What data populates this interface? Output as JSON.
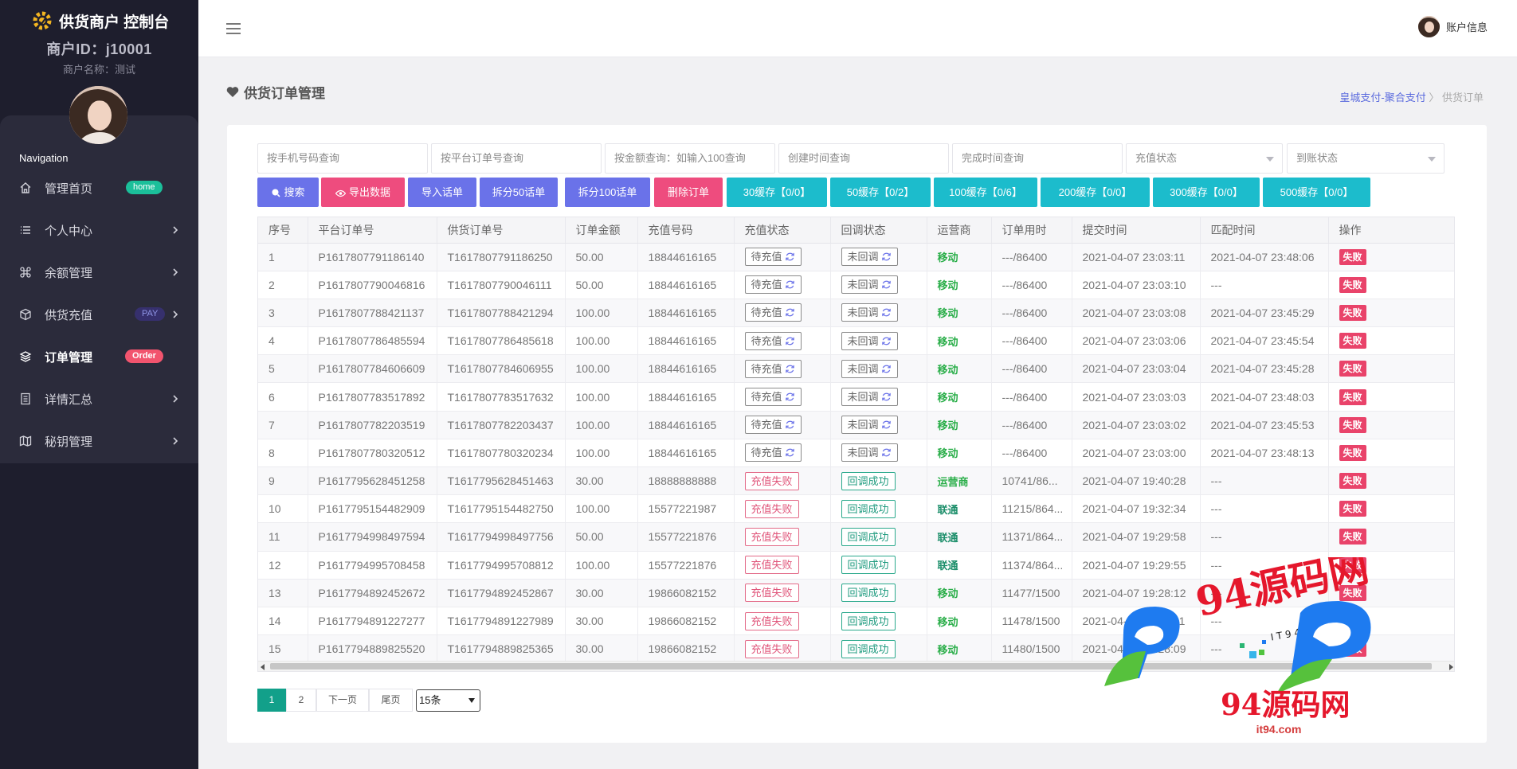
{
  "sidebar": {
    "brand": "供货商户 控制台",
    "merchant_id": "商户ID：j10001",
    "merchant_name": "商户名称：测试",
    "nav_heading": "Navigation",
    "items": [
      {
        "label": "管理首页",
        "badge": "home",
        "icon": "home-icon"
      },
      {
        "label": "个人中心",
        "icon": "list-icon"
      },
      {
        "label": "余额管理",
        "icon": "command-icon"
      },
      {
        "label": "供货充值",
        "badge": "PAY",
        "icon": "box-icon"
      },
      {
        "label": "订单管理",
        "badge": "Order",
        "icon": "layers-icon",
        "active": true
      },
      {
        "label": "详情汇总",
        "icon": "document-icon"
      },
      {
        "label": "秘钥管理",
        "icon": "map-icon"
      }
    ]
  },
  "topbar": {
    "account": "账户信息"
  },
  "page": {
    "title": "供货订单管理",
    "breadcrumb_link": "皇城支付-聚合支付",
    "breadcrumb_sep": "〉",
    "breadcrumb_current": "供货订单"
  },
  "filters": {
    "phone": "按手机号码查询",
    "platform_order": "按平台订单号查询",
    "amount": "按金额查询：如输入100查询",
    "created_time": "创建时间查询",
    "finished_time": "完成时间查询",
    "recharge_status": "充值状态",
    "settle_status": "到账状态"
  },
  "buttons": {
    "search": "搜索",
    "export": "导出数据",
    "import": "导入话单",
    "split50": "拆分50话单",
    "split100": "拆分100话单",
    "delete": "删除订单",
    "cache30": "30缓存【0/0】",
    "cache50": "50缓存【0/2】",
    "cache100": "100缓存【0/6】",
    "cache200": "200缓存【0/0】",
    "cache300": "300缓存【0/0】",
    "cache500": "500缓存【0/0】"
  },
  "colors": {
    "primary": "#6a72e9",
    "pink": "#ee4c7e",
    "teal": "#1cbccc",
    "sidebar": "#1e1e2d",
    "active_page": "#12a08a"
  },
  "table": {
    "headers": [
      "序号",
      "平台订单号",
      "供货订单号",
      "订单金额",
      "充值号码",
      "充值状态",
      "回调状态",
      "运营商",
      "订单用时",
      "提交时间",
      "匹配时间",
      "操作"
    ],
    "rows": [
      [
        "1",
        "P1617807791186140",
        "T1617807791186250",
        "50.00",
        "18844616165",
        "待充值",
        "未回调",
        "移动",
        "---/86400",
        "2021-04-07 23:03:11",
        "2021-04-07 23:48:06",
        "失败"
      ],
      [
        "2",
        "P1617807790046816",
        "T1617807790046111",
        "50.00",
        "18844616165",
        "待充值",
        "未回调",
        "移动",
        "---/86400",
        "2021-04-07 23:03:10",
        "---",
        "失败"
      ],
      [
        "3",
        "P1617807788421137",
        "T1617807788421294",
        "100.00",
        "18844616165",
        "待充值",
        "未回调",
        "移动",
        "---/86400",
        "2021-04-07 23:03:08",
        "2021-04-07 23:45:29",
        "失败"
      ],
      [
        "4",
        "P1617807786485594",
        "T1617807786485618",
        "100.00",
        "18844616165",
        "待充值",
        "未回调",
        "移动",
        "---/86400",
        "2021-04-07 23:03:06",
        "2021-04-07 23:45:54",
        "失败"
      ],
      [
        "5",
        "P1617807784606609",
        "T1617807784606955",
        "100.00",
        "18844616165",
        "待充值",
        "未回调",
        "移动",
        "---/86400",
        "2021-04-07 23:03:04",
        "2021-04-07 23:45:28",
        "失败"
      ],
      [
        "6",
        "P1617807783517892",
        "T1617807783517632",
        "100.00",
        "18844616165",
        "待充值",
        "未回调",
        "移动",
        "---/86400",
        "2021-04-07 23:03:03",
        "2021-04-07 23:48:03",
        "失败"
      ],
      [
        "7",
        "P1617807782203519",
        "T1617807782203437",
        "100.00",
        "18844616165",
        "待充值",
        "未回调",
        "移动",
        "---/86400",
        "2021-04-07 23:03:02",
        "2021-04-07 23:45:53",
        "失败"
      ],
      [
        "8",
        "P1617807780320512",
        "T1617807780320234",
        "100.00",
        "18844616165",
        "待充值",
        "未回调",
        "移动",
        "---/86400",
        "2021-04-07 23:03:00",
        "2021-04-07 23:48:13",
        "失败"
      ],
      [
        "9",
        "P1617795628451258",
        "T1617795628451463",
        "30.00",
        "18888888888",
        "充值失败",
        "回调成功",
        "运营商",
        "10741/86...",
        "2021-04-07 19:40:28",
        "---",
        "失败"
      ],
      [
        "10",
        "P1617795154482909",
        "T1617795154482750",
        "100.00",
        "15577221987",
        "充值失败",
        "回调成功",
        "联通",
        "11215/864...",
        "2021-04-07 19:32:34",
        "---",
        "失败"
      ],
      [
        "11",
        "P1617794998497594",
        "T1617794998497756",
        "50.00",
        "15577221876",
        "充值失败",
        "回调成功",
        "联通",
        "11371/864...",
        "2021-04-07 19:29:58",
        "---",
        "失败"
      ],
      [
        "12",
        "P1617794995708458",
        "T1617794995708812",
        "100.00",
        "15577221876",
        "充值失败",
        "回调成功",
        "联通",
        "11374/864...",
        "2021-04-07 19:29:55",
        "---",
        "失败"
      ],
      [
        "13",
        "P1617794892452672",
        "T1617794892452867",
        "30.00",
        "19866082152",
        "充值失败",
        "回调成功",
        "移动",
        "11477/1500",
        "2021-04-07 19:28:12",
        "---",
        "失败"
      ],
      [
        "14",
        "P1617794891227277",
        "T1617794891227989",
        "30.00",
        "19866082152",
        "充值失败",
        "回调成功",
        "移动",
        "11478/1500",
        "2021-04-07 19:28:11",
        "---",
        "失败"
      ],
      [
        "15",
        "P1617794889825520",
        "T1617794889825365",
        "30.00",
        "19866082152",
        "充值失败",
        "回调成功",
        "移动",
        "11480/1500",
        "2021-04-07 19:28:09",
        "---",
        "失败"
      ]
    ]
  },
  "pagination": {
    "pages": [
      "1",
      "2"
    ],
    "next": "下一页",
    "last": "尾页",
    "page_size": "15条"
  },
  "watermark": {
    "text": "94源码网",
    "url": "it94.com",
    "dotcom": ". C O M",
    "mid": "I T 9 4"
  }
}
